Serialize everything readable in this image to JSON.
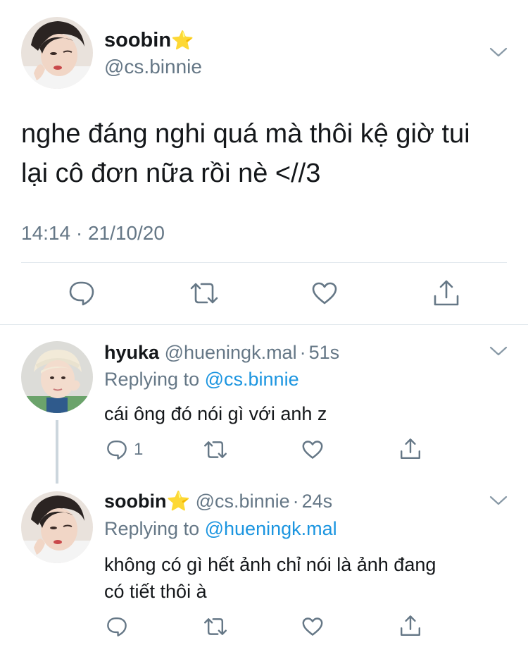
{
  "main_tweet": {
    "display_name": "soobin",
    "name_emoji": "⭐",
    "handle": "@cs.binnie",
    "text_line1": "nghe đáng nghi quá mà thôi kệ giờ tui",
    "text_line2": "lại cô đơn nữa rồi nè <//3",
    "timestamp": "14:14 · 21/10/20"
  },
  "replies": [
    {
      "display_name": "hyuka",
      "handle": "@hueningk.mal",
      "separator": "·",
      "time": "51s",
      "replying_label": "Replying to",
      "replying_to": "@cs.binnie",
      "text": "cái ông đó nói gì với anh z",
      "reply_count": "1"
    },
    {
      "display_name": "soobin",
      "name_emoji": "⭐",
      "handle": "@cs.binnie",
      "separator": "·",
      "time": "24s",
      "replying_label": "Replying to",
      "replying_to": "@hueningk.mal",
      "text_line1": "không có gì hết ảnh chỉ nói là ảnh đang",
      "text_line2": "có tiết thôi à",
      "reply_count": ""
    }
  ],
  "icons": [
    "reply-icon",
    "retweet-icon",
    "like-icon",
    "share-icon",
    "chevron-down-icon"
  ],
  "colors": {
    "text": "#14171a",
    "secondary": "#657786",
    "link": "#1b95e0",
    "divider": "#e1e8ed",
    "star": "#ffcc33"
  }
}
